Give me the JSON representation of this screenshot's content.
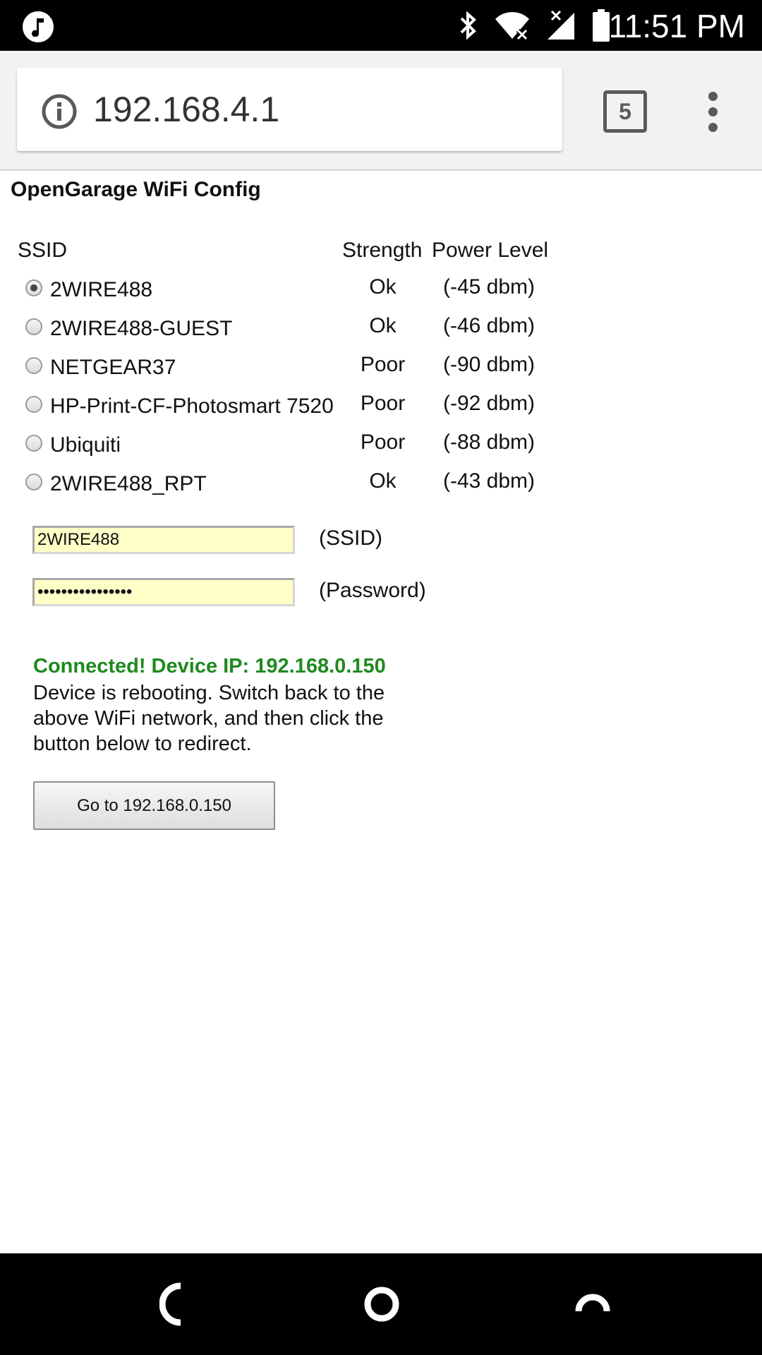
{
  "status_bar": {
    "time": "11:51 PM",
    "icons": [
      "music-note-icon",
      "bluetooth-icon",
      "wifi-icon",
      "cell-signal-icon",
      "battery-icon"
    ]
  },
  "browser": {
    "url": "192.168.4.1",
    "tab_count": "5"
  },
  "page": {
    "title": "OpenGarage WiFi Config",
    "headers": {
      "ssid": "SSID",
      "strength": "Strength",
      "power": "Power Level"
    },
    "networks": [
      {
        "name": "2WIRE488",
        "strength": "Ok",
        "power": "(-45 dbm)",
        "selected": true
      },
      {
        "name": "2WIRE488-GUEST",
        "strength": "Ok",
        "power": "(-46 dbm)",
        "selected": false
      },
      {
        "name": "NETGEAR37",
        "strength": "Poor",
        "power": "(-90 dbm)",
        "selected": false
      },
      {
        "name": "HP-Print-CF-Photosmart 7520",
        "strength": "Poor",
        "power": "(-92 dbm)",
        "selected": false
      },
      {
        "name": "Ubiquiti",
        "strength": "Poor",
        "power": "(-88 dbm)",
        "selected": false
      },
      {
        "name": "2WIRE488_RPT",
        "strength": "Ok",
        "power": "(-43 dbm)",
        "selected": false
      }
    ],
    "ssid_field": {
      "value": "2WIRE488",
      "label": "(SSID)"
    },
    "password_field": {
      "value": "••••••••••••••••",
      "label": "(Password)"
    },
    "connected_msg": "Connected! Device IP: 192.168.0.150",
    "reboot_msg": "Device is rebooting. Switch back to the above WiFi network, and then click the button below to redirect.",
    "redirect_button": "Go to 192.168.0.150"
  },
  "colors": {
    "connected_green": "#1e8a1e",
    "field_background": "#ffffc8"
  }
}
